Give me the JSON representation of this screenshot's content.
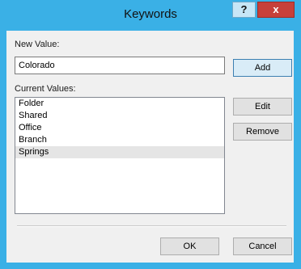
{
  "window": {
    "title": "Keywords",
    "help_label": "?",
    "close_label": "x",
    "accent": "#3ab0e6"
  },
  "form": {
    "new_value_label": "New Value:",
    "new_value": "Colorado",
    "add_label": "Add",
    "current_values_label": "Current Values:",
    "values": [
      {
        "label": "Folder",
        "selected": false
      },
      {
        "label": "Shared",
        "selected": false
      },
      {
        "label": "Office",
        "selected": false
      },
      {
        "label": "Branch",
        "selected": false
      },
      {
        "label": "Springs",
        "selected": true
      }
    ],
    "edit_label": "Edit",
    "remove_label": "Remove"
  },
  "footer": {
    "ok_label": "OK",
    "cancel_label": "Cancel"
  }
}
